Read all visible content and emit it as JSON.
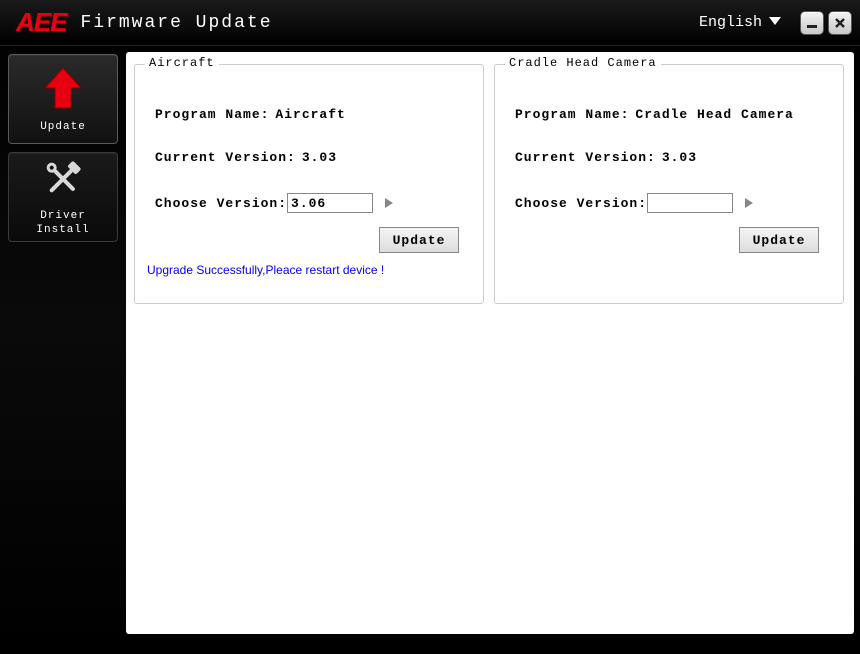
{
  "header": {
    "logo": "AEE",
    "title": "Firmware Update",
    "language": "English"
  },
  "sidebar": {
    "update": "Update",
    "driver": "Driver\nInstall"
  },
  "panels": {
    "aircraft": {
      "legend": "Aircraft",
      "program_label": "Program Name:",
      "program_value": "Aircraft",
      "current_label": "Current Version:",
      "current_value": "3.03",
      "choose_label": "Choose Version:",
      "choose_value": "3.06",
      "button": "Update",
      "status": "Upgrade Successfully,Pleace restart device !"
    },
    "cradle": {
      "legend": "Cradle Head Camera",
      "program_label": "Program Name:",
      "program_value": "Cradle Head Camera",
      "current_label": "Current Version:",
      "current_value": "3.03",
      "choose_label": "Choose Version:",
      "choose_value": "",
      "button": "Update"
    }
  }
}
